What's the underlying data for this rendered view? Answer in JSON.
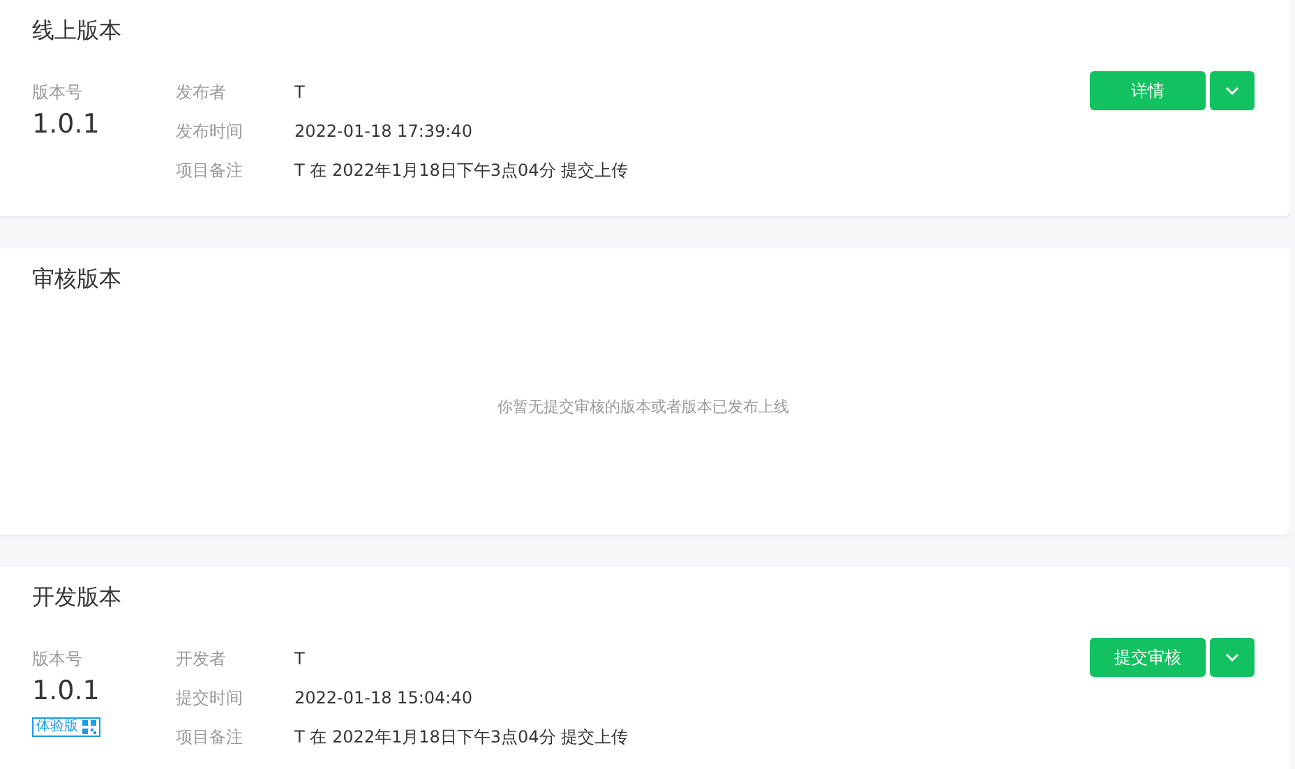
{
  "sections": [
    {
      "kind": "version",
      "title": "线上版本",
      "version_label": "版本号",
      "version": "1.0.1",
      "fields": [
        {
          "label": "发布者",
          "value": "T"
        },
        {
          "label": "发布时间",
          "value": "2022-01-18 17:39:40"
        },
        {
          "label": "项目备注",
          "value": "T 在 2022年1月18日下午3点04分 提交上传"
        }
      ],
      "button": "详情"
    },
    {
      "kind": "empty",
      "title": "审核版本",
      "message": "你暂无提交审核的版本或者版本已发布上线"
    },
    {
      "kind": "version",
      "title": "开发版本",
      "version_label": "版本号",
      "version": "1.0.1",
      "tag": "体验版",
      "fields": [
        {
          "label": "开发者",
          "value": "T"
        },
        {
          "label": "提交时间",
          "value": "2022-01-18 15:04:40"
        },
        {
          "label": "项目备注",
          "value": "T 在 2022年1月18日下午3点04分 提交上传"
        }
      ],
      "button": "提交审核"
    }
  ]
}
